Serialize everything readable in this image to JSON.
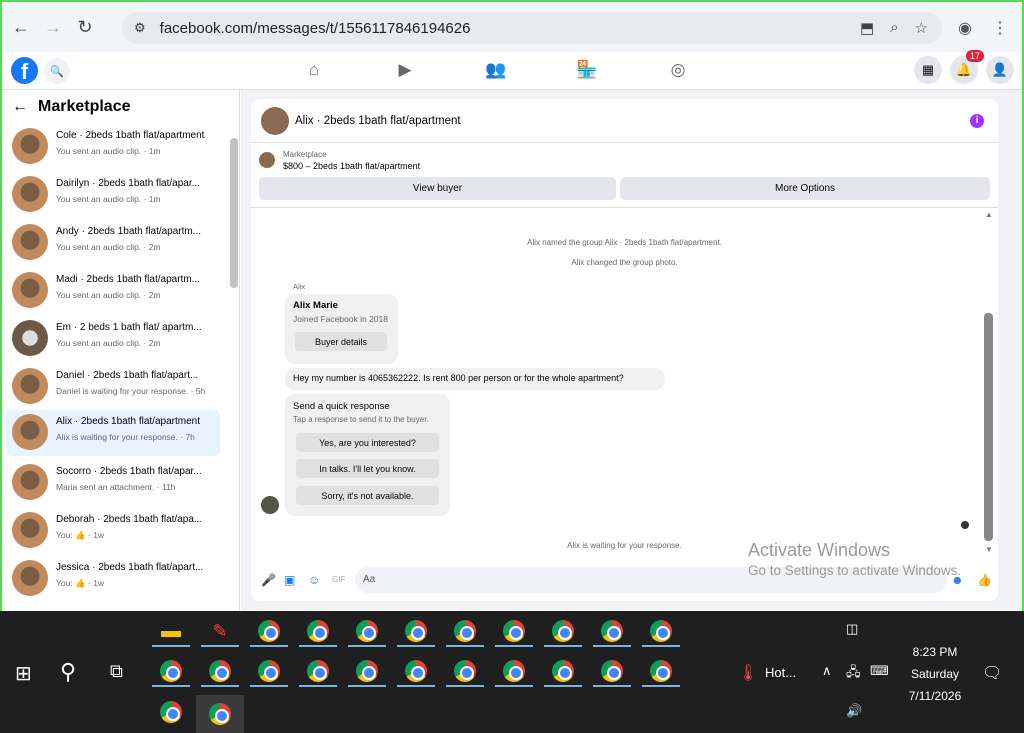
{
  "browser": {
    "url": "facebook.com/messages/t/1556117846194626"
  },
  "fb": {
    "notif_count": "17"
  },
  "left": {
    "title": "Marketplace",
    "conversations": [
      {
        "title": "Cole · 2beds 1bath flat/apartment",
        "sub": "You sent an audio clip. · 1m"
      },
      {
        "title": "Dairilyn · 2beds 1bath flat/apar...",
        "sub": "You sent an audio clip. · 1m"
      },
      {
        "title": "Andy · 2beds 1bath flat/apartm...",
        "sub": "You sent an audio clip. · 2m"
      },
      {
        "title": "Madi · 2beds 1bath flat/apartm...",
        "sub": "You sent an audio clip. · 2m"
      },
      {
        "title": "Em · 2 beds 1 bath flat/ apartm...",
        "sub": "You sent an audio clip. · 2m"
      },
      {
        "title": "Daniel · 2beds 1bath flat/apart...",
        "sub": "Daniel is waiting for your response. · 5h"
      },
      {
        "title": "Alix · 2beds 1bath flat/apartment",
        "sub": "Alix is waiting for your response. · 7h"
      },
      {
        "title": "Socorro · 2beds 1bath flat/apar...",
        "sub": "Maria sent an attachment. · 11h"
      },
      {
        "title": "Deborah · 2beds 1bath flat/apa...",
        "sub": "You: 👍 · 1w"
      },
      {
        "title": "Jessica · 2beds 1bath flat/apart...",
        "sub": "You: 👍 · 1w"
      }
    ]
  },
  "chat": {
    "title": "Alix · 2beds 1bath flat/apartment",
    "mp_label": "Marketplace",
    "mp_price": "$800 – 2beds 1bath flat/apartment",
    "view_buyer": "View buyer",
    "more_options": "More Options",
    "sys1": "Alix named the group Alix · 2beds 1bath flat/apartment.",
    "sys2": "Alix changed the group photo.",
    "sender": "Alix",
    "card_name": "Alix Marie",
    "card_sub": "Joined Facebook in 2018",
    "buyer_details": "Buyer details",
    "msg": "Hey my number is 4065362222. Is rent 800 per person or for the whole apartment?",
    "quick_title": "Send a quick response",
    "quick_sub": "Tap a response to send it to the buyer.",
    "q1": "Yes, are you interested?",
    "q2": "In talks. I'll let you know.",
    "q3": "Sorry, it's not available.",
    "waiting": "Alix is waiting for your response.",
    "input_placeholder": "Aa"
  },
  "watermark": {
    "line1": "Activate Windows",
    "line2": "Go to Settings to activate Windows."
  },
  "taskbar": {
    "weather": "Hot...",
    "time": "8:23 PM",
    "day": "Saturday",
    "date": "7/11/2026"
  }
}
